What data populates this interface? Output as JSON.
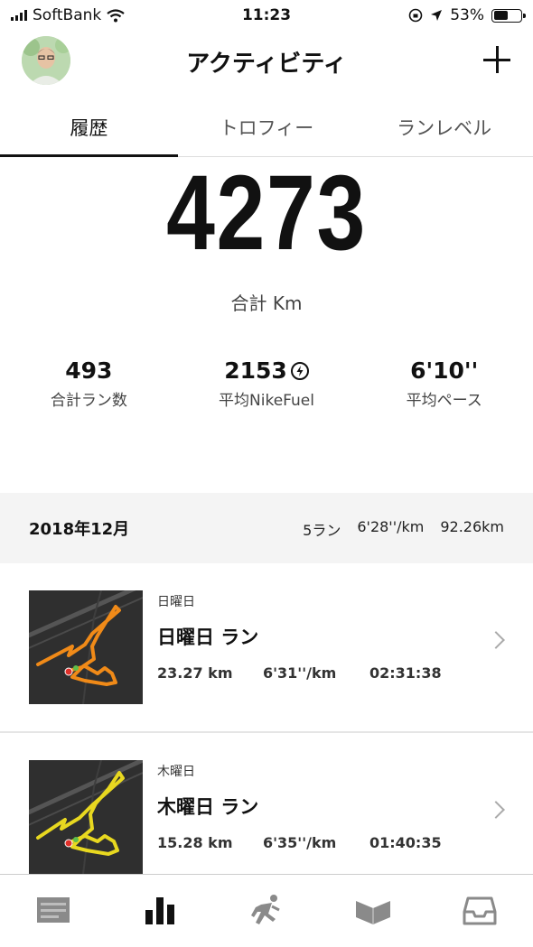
{
  "status_bar": {
    "carrier": "SoftBank",
    "time": "11:23",
    "battery": "53%"
  },
  "header": {
    "title": "アクティビティ"
  },
  "tabs": [
    {
      "label": "履歴",
      "active": true
    },
    {
      "label": "トロフィー",
      "active": false
    },
    {
      "label": "ランレベル",
      "active": false
    }
  ],
  "totals": {
    "distance": "4273",
    "distance_label": "合計 Km",
    "stats": [
      {
        "value": "493",
        "label": "合計ラン数"
      },
      {
        "value": "2153",
        "label": "平均NikeFuel"
      },
      {
        "value": "6'10''",
        "label": "平均ペース"
      }
    ]
  },
  "month": {
    "title": "2018年12月",
    "runs": "5ラン",
    "pace": "6'28''/km",
    "distance": "92.26km"
  },
  "runs": [
    {
      "day": "日曜日",
      "title": "日曜日 ラン",
      "distance": "23.27 km",
      "pace": "6'31''/km",
      "duration": "02:31:38",
      "route_color": "#f08a18"
    },
    {
      "day": "木曜日",
      "title": "木曜日 ラン",
      "distance": "15.28 km",
      "pace": "6'35''/km",
      "duration": "01:40:35",
      "route_color": "#e8d820"
    }
  ],
  "bottom_nav": [
    {
      "icon": "feed-icon"
    },
    {
      "icon": "activity-icon",
      "active": true
    },
    {
      "icon": "run-icon"
    },
    {
      "icon": "clubs-icon"
    },
    {
      "icon": "inbox-icon"
    }
  ]
}
